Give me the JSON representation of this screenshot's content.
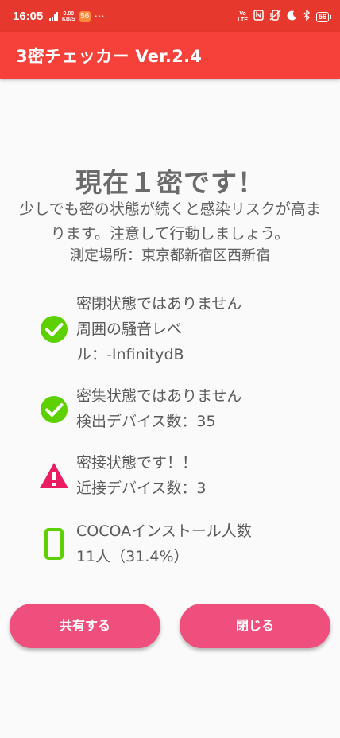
{
  "status_bar": {
    "time": "16:05",
    "net_speed_value": "0.00",
    "net_speed_unit": "KB/S",
    "app_badge": "56",
    "more": "···",
    "volte_top": "Vo",
    "volte_bottom": "LTE",
    "battery": "56",
    "icons": [
      "signal-icon",
      "nfc-icon",
      "vibrate-icon",
      "moon-icon",
      "bluetooth-icon",
      "battery-icon"
    ]
  },
  "toolbar": {
    "title": "3密チェッカー Ver.2.4",
    "color": "#f5413a"
  },
  "main": {
    "headline": "現在１密です！",
    "warning_line1": "少しでも密の状態が続くと感染リスクが高ま",
    "warning_line2": "ります。注意して行動しましょう。",
    "location": "測定場所：東京都新宿区西新宿"
  },
  "checks": {
    "closed": {
      "status": "密閉状態ではありません",
      "detail_line1": "周囲の騒音レベ",
      "detail_line2": "ル：-InfinitydB",
      "icon": "check-circle-icon",
      "color": "#5dd100"
    },
    "crowded": {
      "status": "密集状態ではありません",
      "detail": "検出デバイス数：35",
      "icon": "check-circle-icon",
      "color": "#5dd100"
    },
    "close_contact": {
      "status": "密接状態です！！",
      "detail": "近接デバイス数：3",
      "icon": "warning-triangle-icon",
      "color": "#ea1d63"
    },
    "cocoa": {
      "status": "COCOAインストール人数",
      "detail": "11人（31.4%）",
      "icon": "smartphone-icon",
      "color": "#5dd100"
    }
  },
  "buttons": {
    "share": "共有する",
    "close": "閉じる",
    "color": "#ee4f7c"
  }
}
